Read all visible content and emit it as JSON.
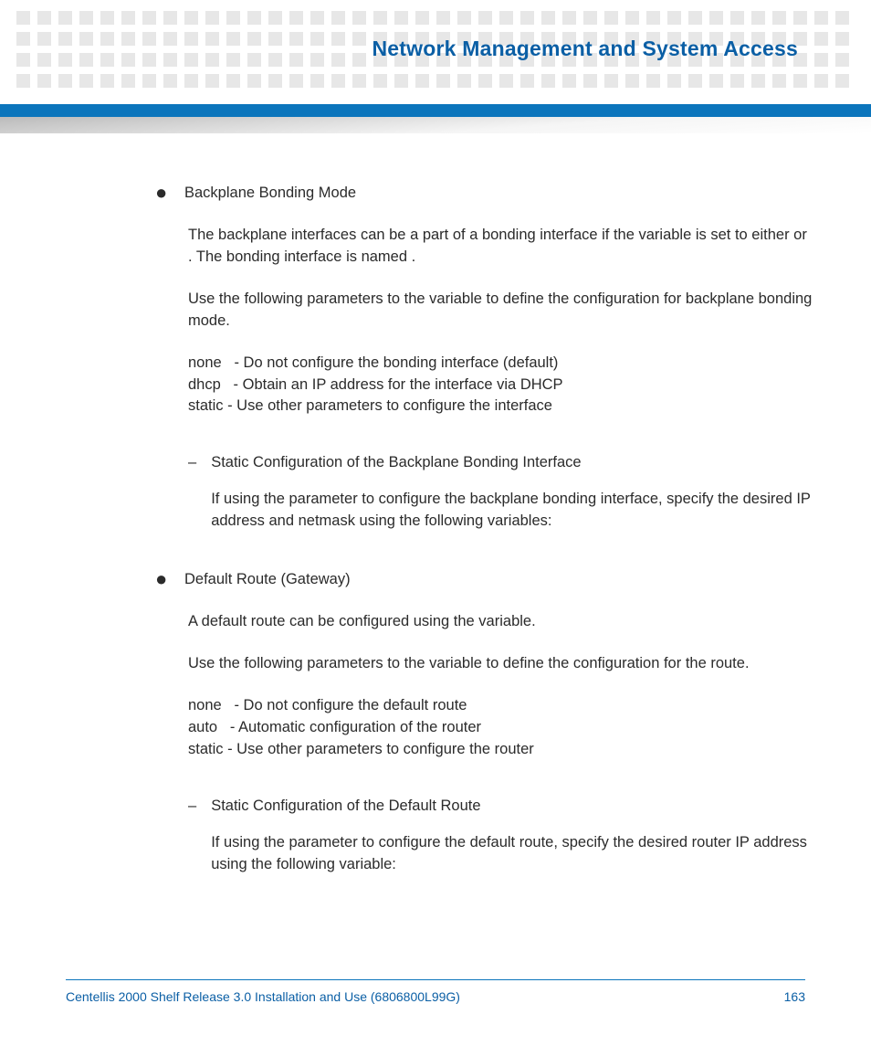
{
  "header": {
    "title": "Network Management and System Access"
  },
  "sections": [
    {
      "heading": "Backplane Bonding Mode",
      "paras": [
        "The backplane interfaces can be a part of a bonding interface if the                                variable is set to either               or                 . The bonding interface is named                 .",
        "Use the following parameters to the                                    variable to define the configuration for backplane bonding mode."
      ],
      "options": "none   - Do not configure the bonding interface (default)\ndhcp   - Obtain an IP address for the interface via DHCP\nstatic - Use other parameters to configure the interface",
      "sub": {
        "title": "Static Configuration of the Backplane Bonding Interface",
        "para": "If using the                   parameter to configure the backplane bonding interface, specify the desired IP address and netmask using the following variables:"
      }
    },
    {
      "heading": "Default Route (Gateway)",
      "paras": [
        "A default route can be configured using the                                        variable.",
        "Use the following parameters to the                                    variable to define the configuration for the route."
      ],
      "options": "none   - Do not configure the default route\nauto   - Automatic configuration of the router\nstatic - Use other parameters to configure the router",
      "sub": {
        "title": "Static Configuration of the Default Route",
        "para": "If using the                   parameter to configure the default route, specify the desired router IP address using the following variable:"
      }
    }
  ],
  "footer": {
    "doc": "Centellis 2000 Shelf Release 3.0 Installation and Use (6806800L99G)",
    "page": "163"
  }
}
